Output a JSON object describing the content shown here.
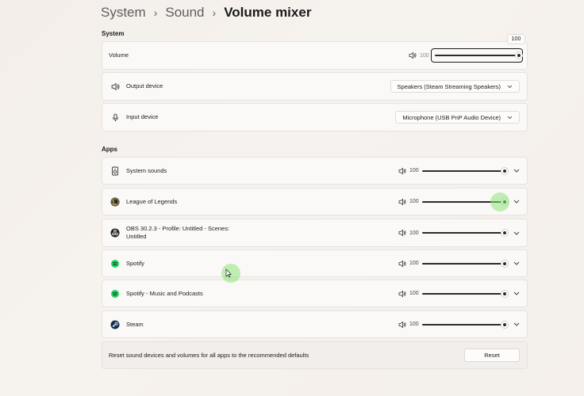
{
  "breadcrumb": {
    "items": [
      "System",
      "Sound"
    ],
    "current": "Volume mixer"
  },
  "system_section": {
    "title": "System",
    "volume": {
      "label": "Volume",
      "value": "100",
      "tooltip": "100",
      "level": 1.0
    },
    "output_device": {
      "label": "Output device",
      "selected": "Speakers (Steam Streaming Speakers)"
    },
    "input_device": {
      "label": "Input device",
      "selected": "Microphone (USB PnP Audio Device)"
    }
  },
  "apps_section": {
    "title": "Apps",
    "apps": [
      {
        "name": "System sounds",
        "value": "100",
        "level": 1.0,
        "icon": "system-sounds-icon"
      },
      {
        "name": "League of Legends",
        "value": "100",
        "level": 1.0,
        "icon": "league-of-legends-icon"
      },
      {
        "name": "OBS 30.2.3 - Profile: Untitled - Scenes: Untitled",
        "value": "100",
        "level": 1.0,
        "icon": "obs-icon"
      },
      {
        "name": "Spotify",
        "value": "100",
        "level": 1.0,
        "icon": "spotify-icon"
      },
      {
        "name": "Spotify - Music and Podcasts",
        "value": "100",
        "level": 1.0,
        "icon": "spotify-icon"
      },
      {
        "name": "Steam",
        "value": "100",
        "level": 1.0,
        "icon": "steam-icon"
      }
    ]
  },
  "reset": {
    "description": "Reset sound devices and volumes for all apps to the recommended defaults",
    "button_label": "Reset"
  },
  "colors": {
    "accent_highlight": "#8ce678",
    "spotify_green": "#1ed760",
    "slider_track": "#2b2b2b"
  }
}
